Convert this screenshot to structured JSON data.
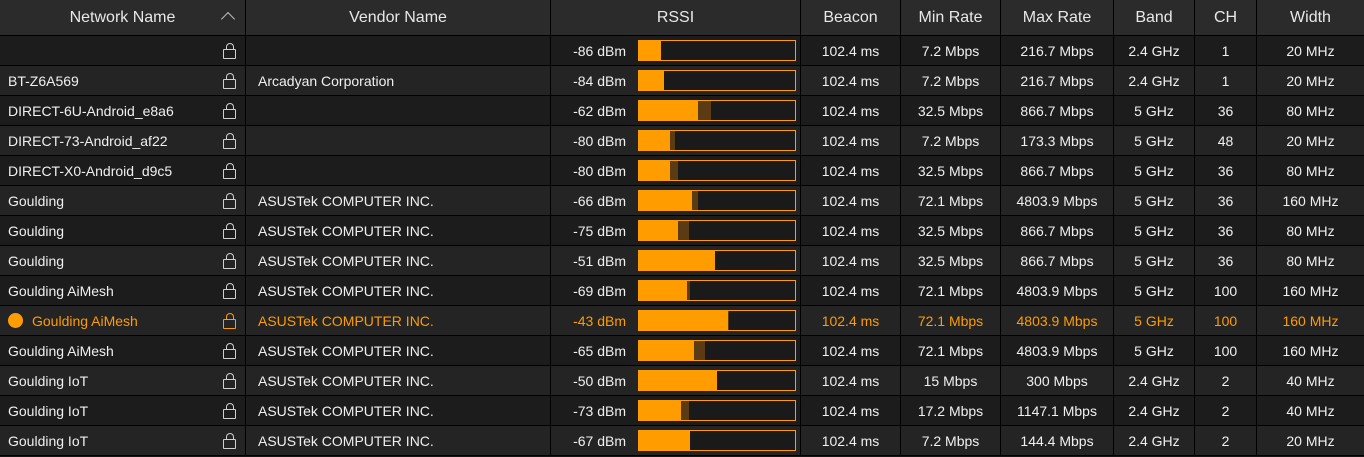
{
  "columns": {
    "name": "Network Name",
    "vendor": "Vendor Name",
    "rssi": "RSSI",
    "beacon": "Beacon",
    "min_rate": "Min Rate",
    "max_rate": "Max Rate",
    "band": "Band",
    "ch": "CH",
    "width": "Width"
  },
  "colors": {
    "accent": "#ff9c00",
    "peak": "#5a3b14",
    "row_a": "#1c1c1c",
    "row_b": "#242424"
  },
  "icons": {
    "sort": "chevron-up-icon",
    "security": "lock-icon",
    "selection": "dot-icon"
  },
  "networks": [
    {
      "name": "",
      "vendor": "",
      "rssi": "-86 dBm",
      "signal": 0.14,
      "peak": 0.14,
      "beacon": "102.4 ms",
      "min_rate": "7.2 Mbps",
      "max_rate": "216.7 Mbps",
      "band": "2.4 GHz",
      "ch": "1",
      "width": "20 MHz"
    },
    {
      "name": "BT-Z6A569",
      "vendor": "Arcadyan Corporation",
      "rssi": "-84 dBm",
      "signal": 0.16,
      "peak": 0.16,
      "beacon": "102.4 ms",
      "min_rate": "7.2 Mbps",
      "max_rate": "216.7 Mbps",
      "band": "2.4 GHz",
      "ch": "1",
      "width": "20 MHz"
    },
    {
      "name": "DIRECT-6U-Android_e8a6",
      "vendor": "",
      "rssi": "-62 dBm",
      "signal": 0.38,
      "peak": 0.46,
      "beacon": "102.4 ms",
      "min_rate": "32.5 Mbps",
      "max_rate": "866.7 Mbps",
      "band": "5 GHz",
      "ch": "36",
      "width": "80 MHz"
    },
    {
      "name": "DIRECT-73-Android_af22",
      "vendor": "",
      "rssi": "-80 dBm",
      "signal": 0.2,
      "peak": 0.23,
      "beacon": "102.4 ms",
      "min_rate": "7.2 Mbps",
      "max_rate": "173.3 Mbps",
      "band": "5 GHz",
      "ch": "48",
      "width": "20 MHz"
    },
    {
      "name": "DIRECT-X0-Android_d9c5",
      "vendor": "",
      "rssi": "-80 dBm",
      "signal": 0.2,
      "peak": 0.25,
      "beacon": "102.4 ms",
      "min_rate": "32.5 Mbps",
      "max_rate": "866.7 Mbps",
      "band": "5 GHz",
      "ch": "36",
      "width": "80 MHz"
    },
    {
      "name": "Goulding",
      "vendor": "ASUSTek COMPUTER INC.",
      "rssi": "-66 dBm",
      "signal": 0.34,
      "peak": 0.38,
      "beacon": "102.4 ms",
      "min_rate": "72.1 Mbps",
      "max_rate": "4803.9 Mbps",
      "band": "5 GHz",
      "ch": "36",
      "width": "160 MHz"
    },
    {
      "name": "Goulding",
      "vendor": "ASUSTek COMPUTER INC.",
      "rssi": "-75 dBm",
      "signal": 0.25,
      "peak": 0.32,
      "beacon": "102.4 ms",
      "min_rate": "32.5 Mbps",
      "max_rate": "866.7 Mbps",
      "band": "5 GHz",
      "ch": "36",
      "width": "80 MHz"
    },
    {
      "name": "Goulding",
      "vendor": "ASUSTek COMPUTER INC.",
      "rssi": "-51 dBm",
      "signal": 0.49,
      "peak": 0.49,
      "beacon": "102.4 ms",
      "min_rate": "32.5 Mbps",
      "max_rate": "866.7 Mbps",
      "band": "5 GHz",
      "ch": "36",
      "width": "80 MHz"
    },
    {
      "name": "Goulding AiMesh",
      "vendor": "ASUSTek COMPUTER INC.",
      "rssi": "-69 dBm",
      "signal": 0.31,
      "peak": 0.33,
      "beacon": "102.4 ms",
      "min_rate": "72.1 Mbps",
      "max_rate": "4803.9 Mbps",
      "band": "5 GHz",
      "ch": "100",
      "width": "160 MHz"
    },
    {
      "name": "Goulding AiMesh",
      "vendor": "ASUSTek COMPUTER INC.",
      "rssi": "-43 dBm",
      "signal": 0.57,
      "peak": 0.58,
      "beacon": "102.4 ms",
      "min_rate": "72.1 Mbps",
      "max_rate": "4803.9 Mbps",
      "band": "5 GHz",
      "ch": "100",
      "width": "160 MHz",
      "selected": true
    },
    {
      "name": "Goulding AiMesh",
      "vendor": "ASUSTek COMPUTER INC.",
      "rssi": "-65 dBm",
      "signal": 0.35,
      "peak": 0.42,
      "beacon": "102.4 ms",
      "min_rate": "72.1 Mbps",
      "max_rate": "4803.9 Mbps",
      "band": "5 GHz",
      "ch": "100",
      "width": "160 MHz"
    },
    {
      "name": "Goulding IoT",
      "vendor": "ASUSTek COMPUTER INC.",
      "rssi": "-50 dBm",
      "signal": 0.5,
      "peak": 0.5,
      "beacon": "102.4 ms",
      "min_rate": "15 Mbps",
      "max_rate": "300 Mbps",
      "band": "2.4 GHz",
      "ch": "2",
      "width": "40 MHz"
    },
    {
      "name": "Goulding IoT",
      "vendor": "ASUSTek COMPUTER INC.",
      "rssi": "-73 dBm",
      "signal": 0.27,
      "peak": 0.32,
      "beacon": "102.4 ms",
      "min_rate": "17.2 Mbps",
      "max_rate": "1147.1 Mbps",
      "band": "2.4 GHz",
      "ch": "2",
      "width": "40 MHz"
    },
    {
      "name": "Goulding IoT",
      "vendor": "ASUSTek COMPUTER INC.",
      "rssi": "-67 dBm",
      "signal": 0.33,
      "peak": 0.33,
      "beacon": "102.4 ms",
      "min_rate": "7.2 Mbps",
      "max_rate": "144.4 Mbps",
      "band": "2.4 GHz",
      "ch": "2",
      "width": "20 MHz"
    }
  ]
}
